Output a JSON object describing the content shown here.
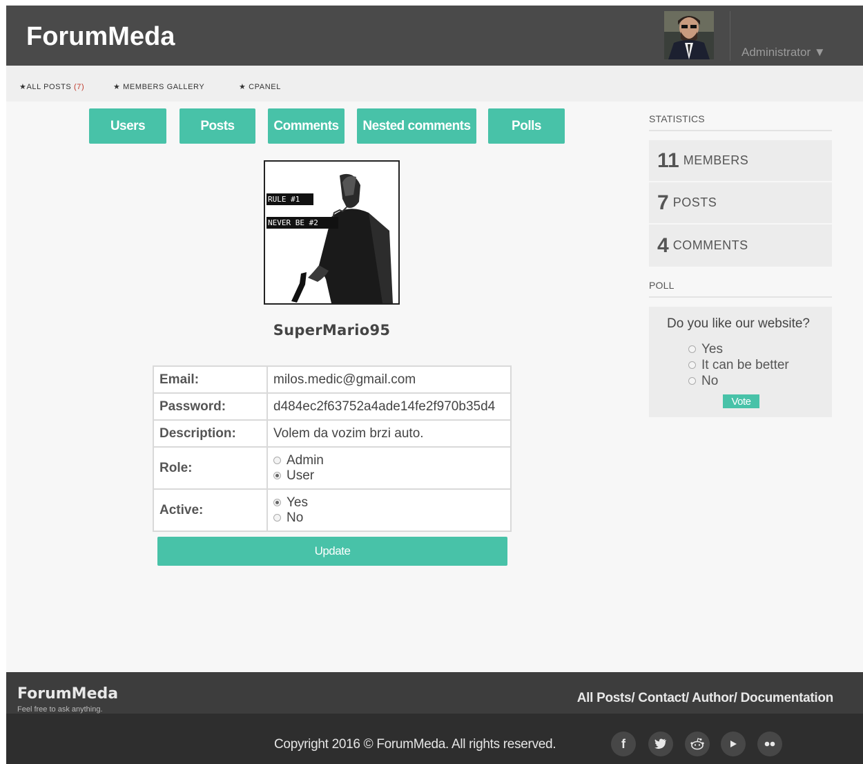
{
  "header": {
    "logo": "ForumMeda",
    "user_menu": "Administrator ▼"
  },
  "topnav": {
    "all_posts_label": "★ALL POSTS",
    "all_posts_count": "(7)",
    "gallery_label": "★ MEMBERS GALLERY",
    "cpanel_label": "★ CPANEL"
  },
  "tabs": [
    {
      "label": "Users"
    },
    {
      "label": "Posts"
    },
    {
      "label": "Comments"
    },
    {
      "label": "Nested comments"
    },
    {
      "label": "Polls"
    }
  ],
  "profile": {
    "image_text_1": "RULE #1",
    "image_text_2": "NEVER BE #2",
    "username": "SuperMario95"
  },
  "form": {
    "email_label": "Email:",
    "email_value": "milos.medic@gmail.com",
    "password_label": "Password:",
    "password_value": "d484ec2f63752a4ade14fe2f970b35d4",
    "description_label": "Description:",
    "description_value": "Volem da vozim brzi auto.",
    "role_label": "Role:",
    "role_options": [
      "Admin",
      "User"
    ],
    "role_selected": "User",
    "active_label": "Active:",
    "active_options": [
      "Yes",
      "No"
    ],
    "active_selected": "Yes",
    "update_label": "Update"
  },
  "sidebar": {
    "statistics_heading": "STATISTICS",
    "stats": [
      {
        "num": "11",
        "label": "members"
      },
      {
        "num": "7",
        "label": "posts"
      },
      {
        "num": "4",
        "label": "comments"
      }
    ],
    "poll_heading": "POLL",
    "poll_question": "Do you like our website?",
    "poll_options": [
      "Yes",
      "It can be better",
      "No"
    ],
    "vote_label": "Vote"
  },
  "footer": {
    "logo": "ForumMeda",
    "tagline": "Feel free to ask anything.",
    "link_all_posts": "All Posts/",
    "link_contact": "Contact/",
    "link_author": "Author/",
    "link_docs": "Documentation",
    "copyright": "Copyright 2016 © ForumMeda. All rights reserved."
  },
  "social_icons": [
    "facebook-icon",
    "twitter-icon",
    "reddit-icon",
    "youtube-icon",
    "flickr-icon"
  ],
  "colors": {
    "accent": "#48c2a8",
    "header_bg": "#4a4a4a",
    "footer_bg": "#2e2e2e"
  }
}
